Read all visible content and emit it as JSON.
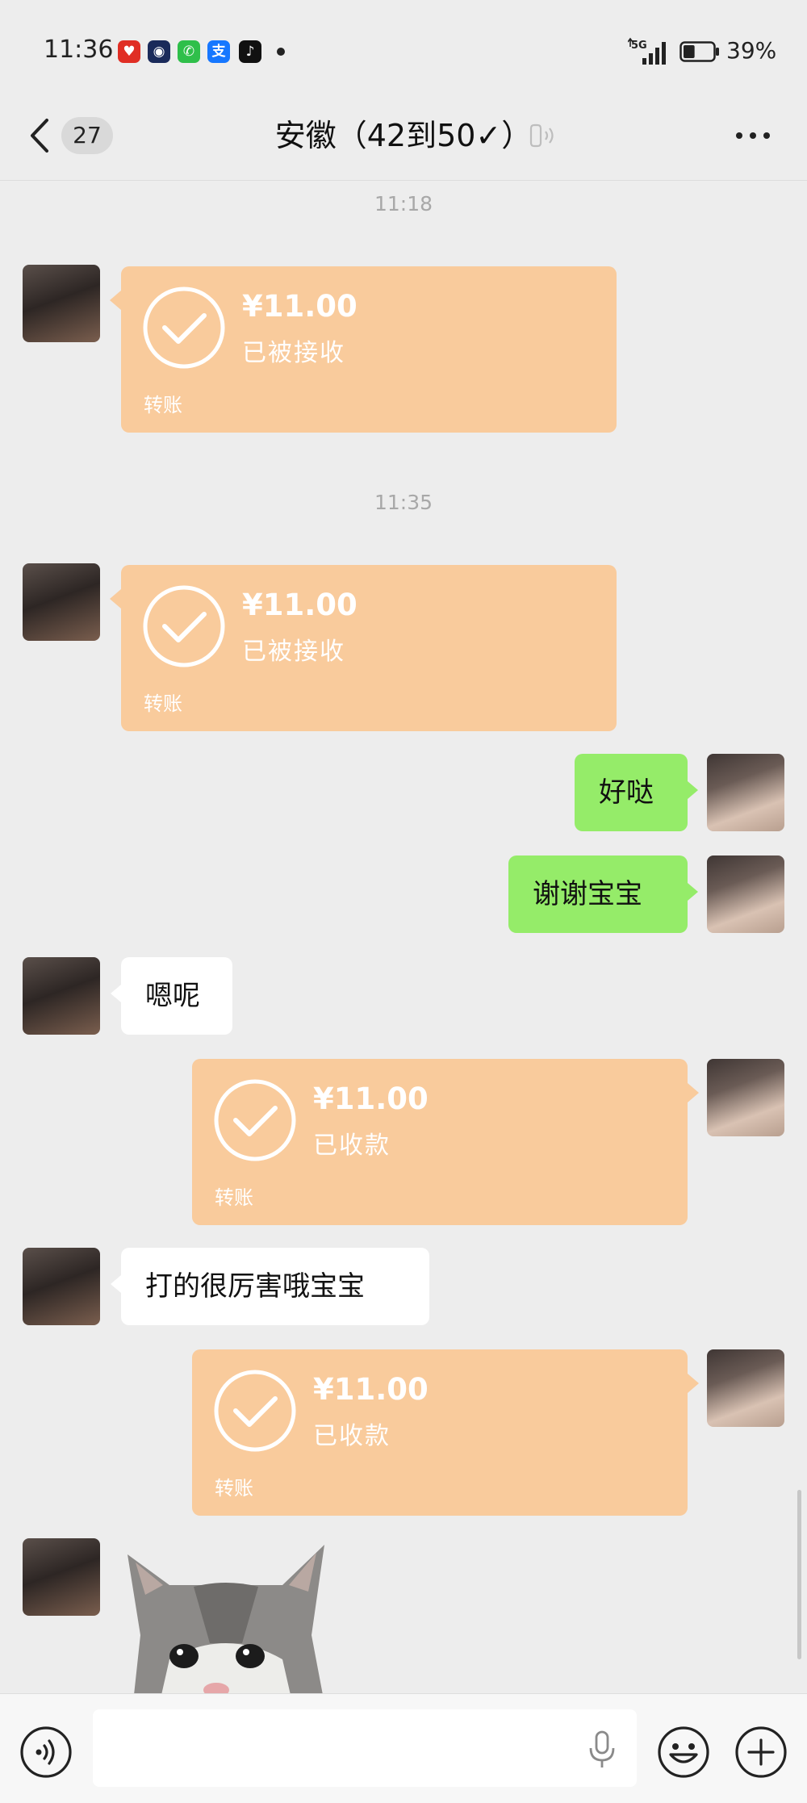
{
  "status_bar": {
    "time": "11:36",
    "network": "5G",
    "battery": "39%",
    "battery_level": 0.39,
    "app_icons": [
      {
        "name": "pinduoduo-icon",
        "color": "#e02e24",
        "glyph": "♥"
      },
      {
        "name": "tv-app-icon",
        "color": "#1a2a5a",
        "glyph": "◉"
      },
      {
        "name": "phone-app-icon",
        "color": "#2fbf4a",
        "glyph": "✆"
      },
      {
        "name": "alipay-icon",
        "color": "#1677ff",
        "glyph": "支"
      },
      {
        "name": "tiktok-icon",
        "color": "#111111",
        "glyph": "♪"
      }
    ]
  },
  "nav": {
    "unread_count": "27",
    "title": "安徽（42到50✓）"
  },
  "colors": {
    "background": "#ededed",
    "transfer": "#f9cb9c",
    "bubble_sent": "#95ec69",
    "bubble_received": "#ffffff"
  },
  "messages": {
    "ts1": "11:18",
    "ts2": "11:35",
    "transfer1": {
      "amount": "¥11.00",
      "status": "已被接收",
      "kind": "转账"
    },
    "transfer2": {
      "amount": "¥11.00",
      "status": "已被接收",
      "kind": "转账"
    },
    "sent1": "好哒",
    "sent2": "谢谢宝宝",
    "recv1": "嗯呢",
    "transfer3": {
      "amount": "¥11.00",
      "status": "已收款",
      "kind": "转账"
    },
    "recv2": "打的很厉害哦宝宝",
    "transfer4": {
      "amount": "¥11.00",
      "status": "已收款",
      "kind": "转账"
    }
  },
  "input": {
    "placeholder": ""
  }
}
